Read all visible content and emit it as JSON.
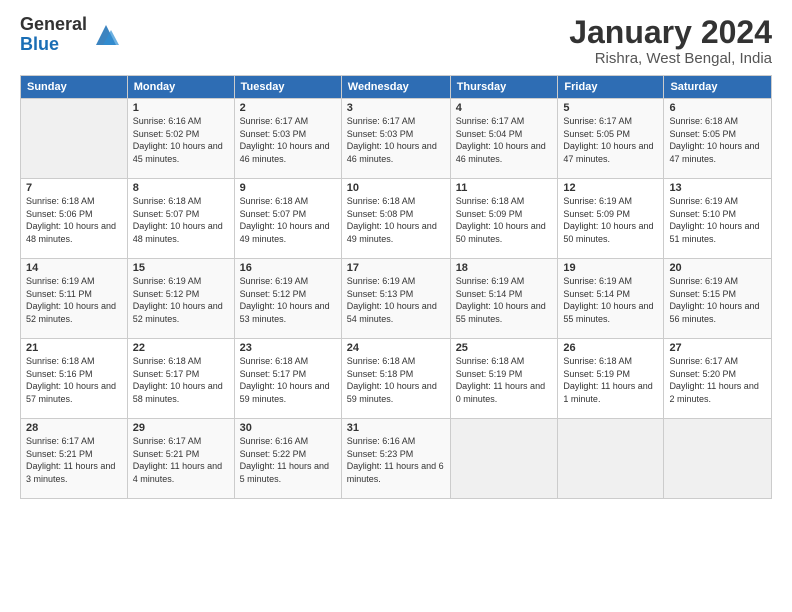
{
  "logo": {
    "general": "General",
    "blue": "Blue"
  },
  "header": {
    "title": "January 2024",
    "location": "Rishra, West Bengal, India"
  },
  "weekdays": [
    "Sunday",
    "Monday",
    "Tuesday",
    "Wednesday",
    "Thursday",
    "Friday",
    "Saturday"
  ],
  "weeks": [
    [
      {
        "day": "",
        "sunrise": "",
        "sunset": "",
        "daylight": ""
      },
      {
        "day": "1",
        "sunrise": "Sunrise: 6:16 AM",
        "sunset": "Sunset: 5:02 PM",
        "daylight": "Daylight: 10 hours and 45 minutes."
      },
      {
        "day": "2",
        "sunrise": "Sunrise: 6:17 AM",
        "sunset": "Sunset: 5:03 PM",
        "daylight": "Daylight: 10 hours and 46 minutes."
      },
      {
        "day": "3",
        "sunrise": "Sunrise: 6:17 AM",
        "sunset": "Sunset: 5:03 PM",
        "daylight": "Daylight: 10 hours and 46 minutes."
      },
      {
        "day": "4",
        "sunrise": "Sunrise: 6:17 AM",
        "sunset": "Sunset: 5:04 PM",
        "daylight": "Daylight: 10 hours and 46 minutes."
      },
      {
        "day": "5",
        "sunrise": "Sunrise: 6:17 AM",
        "sunset": "Sunset: 5:05 PM",
        "daylight": "Daylight: 10 hours and 47 minutes."
      },
      {
        "day": "6",
        "sunrise": "Sunrise: 6:18 AM",
        "sunset": "Sunset: 5:05 PM",
        "daylight": "Daylight: 10 hours and 47 minutes."
      }
    ],
    [
      {
        "day": "7",
        "sunrise": "Sunrise: 6:18 AM",
        "sunset": "Sunset: 5:06 PM",
        "daylight": "Daylight: 10 hours and 48 minutes."
      },
      {
        "day": "8",
        "sunrise": "Sunrise: 6:18 AM",
        "sunset": "Sunset: 5:07 PM",
        "daylight": "Daylight: 10 hours and 48 minutes."
      },
      {
        "day": "9",
        "sunrise": "Sunrise: 6:18 AM",
        "sunset": "Sunset: 5:07 PM",
        "daylight": "Daylight: 10 hours and 49 minutes."
      },
      {
        "day": "10",
        "sunrise": "Sunrise: 6:18 AM",
        "sunset": "Sunset: 5:08 PM",
        "daylight": "Daylight: 10 hours and 49 minutes."
      },
      {
        "day": "11",
        "sunrise": "Sunrise: 6:18 AM",
        "sunset": "Sunset: 5:09 PM",
        "daylight": "Daylight: 10 hours and 50 minutes."
      },
      {
        "day": "12",
        "sunrise": "Sunrise: 6:19 AM",
        "sunset": "Sunset: 5:09 PM",
        "daylight": "Daylight: 10 hours and 50 minutes."
      },
      {
        "day": "13",
        "sunrise": "Sunrise: 6:19 AM",
        "sunset": "Sunset: 5:10 PM",
        "daylight": "Daylight: 10 hours and 51 minutes."
      }
    ],
    [
      {
        "day": "14",
        "sunrise": "Sunrise: 6:19 AM",
        "sunset": "Sunset: 5:11 PM",
        "daylight": "Daylight: 10 hours and 52 minutes."
      },
      {
        "day": "15",
        "sunrise": "Sunrise: 6:19 AM",
        "sunset": "Sunset: 5:12 PM",
        "daylight": "Daylight: 10 hours and 52 minutes."
      },
      {
        "day": "16",
        "sunrise": "Sunrise: 6:19 AM",
        "sunset": "Sunset: 5:12 PM",
        "daylight": "Daylight: 10 hours and 53 minutes."
      },
      {
        "day": "17",
        "sunrise": "Sunrise: 6:19 AM",
        "sunset": "Sunset: 5:13 PM",
        "daylight": "Daylight: 10 hours and 54 minutes."
      },
      {
        "day": "18",
        "sunrise": "Sunrise: 6:19 AM",
        "sunset": "Sunset: 5:14 PM",
        "daylight": "Daylight: 10 hours and 55 minutes."
      },
      {
        "day": "19",
        "sunrise": "Sunrise: 6:19 AM",
        "sunset": "Sunset: 5:14 PM",
        "daylight": "Daylight: 10 hours and 55 minutes."
      },
      {
        "day": "20",
        "sunrise": "Sunrise: 6:19 AM",
        "sunset": "Sunset: 5:15 PM",
        "daylight": "Daylight: 10 hours and 56 minutes."
      }
    ],
    [
      {
        "day": "21",
        "sunrise": "Sunrise: 6:18 AM",
        "sunset": "Sunset: 5:16 PM",
        "daylight": "Daylight: 10 hours and 57 minutes."
      },
      {
        "day": "22",
        "sunrise": "Sunrise: 6:18 AM",
        "sunset": "Sunset: 5:17 PM",
        "daylight": "Daylight: 10 hours and 58 minutes."
      },
      {
        "day": "23",
        "sunrise": "Sunrise: 6:18 AM",
        "sunset": "Sunset: 5:17 PM",
        "daylight": "Daylight: 10 hours and 59 minutes."
      },
      {
        "day": "24",
        "sunrise": "Sunrise: 6:18 AM",
        "sunset": "Sunset: 5:18 PM",
        "daylight": "Daylight: 10 hours and 59 minutes."
      },
      {
        "day": "25",
        "sunrise": "Sunrise: 6:18 AM",
        "sunset": "Sunset: 5:19 PM",
        "daylight": "Daylight: 11 hours and 0 minutes."
      },
      {
        "day": "26",
        "sunrise": "Sunrise: 6:18 AM",
        "sunset": "Sunset: 5:19 PM",
        "daylight": "Daylight: 11 hours and 1 minute."
      },
      {
        "day": "27",
        "sunrise": "Sunrise: 6:17 AM",
        "sunset": "Sunset: 5:20 PM",
        "daylight": "Daylight: 11 hours and 2 minutes."
      }
    ],
    [
      {
        "day": "28",
        "sunrise": "Sunrise: 6:17 AM",
        "sunset": "Sunset: 5:21 PM",
        "daylight": "Daylight: 11 hours and 3 minutes."
      },
      {
        "day": "29",
        "sunrise": "Sunrise: 6:17 AM",
        "sunset": "Sunset: 5:21 PM",
        "daylight": "Daylight: 11 hours and 4 minutes."
      },
      {
        "day": "30",
        "sunrise": "Sunrise: 6:16 AM",
        "sunset": "Sunset: 5:22 PM",
        "daylight": "Daylight: 11 hours and 5 minutes."
      },
      {
        "day": "31",
        "sunrise": "Sunrise: 6:16 AM",
        "sunset": "Sunset: 5:23 PM",
        "daylight": "Daylight: 11 hours and 6 minutes."
      },
      {
        "day": "",
        "sunrise": "",
        "sunset": "",
        "daylight": ""
      },
      {
        "day": "",
        "sunrise": "",
        "sunset": "",
        "daylight": ""
      },
      {
        "day": "",
        "sunrise": "",
        "sunset": "",
        "daylight": ""
      }
    ]
  ]
}
